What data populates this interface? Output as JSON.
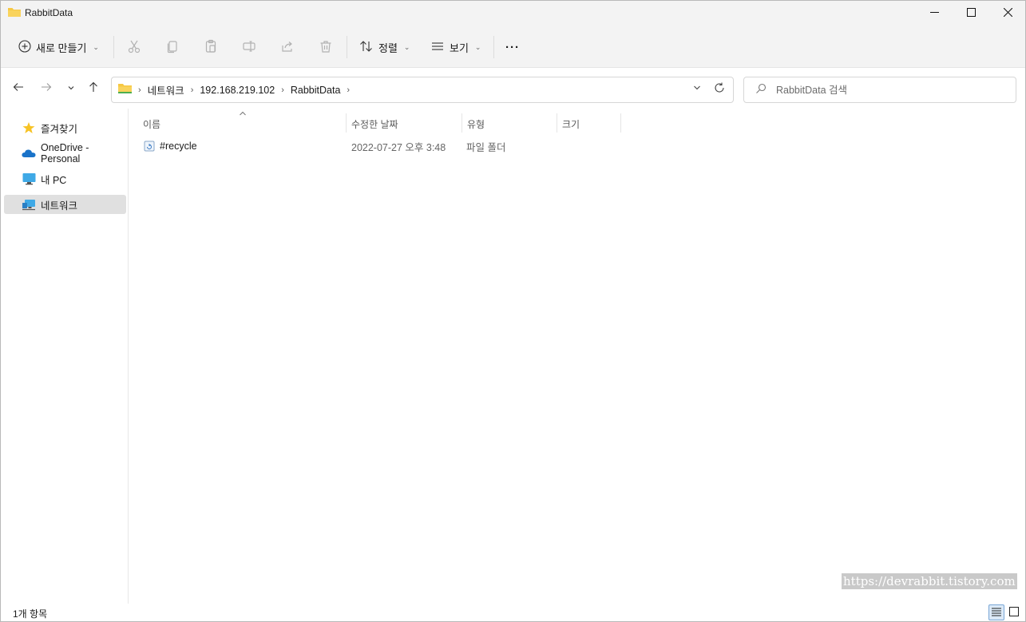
{
  "window": {
    "title": "RabbitData",
    "controls": [
      "minimize-icon",
      "maximize-icon",
      "close-icon"
    ]
  },
  "toolbar": {
    "new_label": "새로 만들기",
    "sort_label": "정렬",
    "view_label": "보기",
    "more_label": "···",
    "disabled_actions": [
      "cut-icon",
      "copy-icon",
      "paste-icon",
      "rename-icon",
      "share-icon",
      "delete-icon"
    ]
  },
  "address": {
    "crumbs": [
      "네트워크",
      "192.168.219.102",
      "RabbitData"
    ]
  },
  "search": {
    "placeholder": "RabbitData 검색"
  },
  "sidebar": {
    "items": [
      {
        "label": "즐겨찾기",
        "icon": "star-icon"
      },
      {
        "label": "OneDrive - Personal",
        "icon": "onedrive-cloud-icon"
      },
      {
        "label": "내 PC",
        "icon": "pc-monitor-icon"
      },
      {
        "label": "네트워크",
        "icon": "network-icon",
        "selected": true
      }
    ]
  },
  "columns": {
    "name": "이름",
    "modified": "수정한 날짜",
    "type": "유형",
    "size": "크기"
  },
  "files": [
    {
      "name": "#recycle",
      "modified": "2022-07-27 오후 3:48",
      "type": "파일 폴더",
      "size": "",
      "icon": "recycle-folder-icon"
    }
  ],
  "status": {
    "count": "1개 항목"
  },
  "watermark": "https://devrabbit.tistory.com",
  "colors": {
    "chrome": "#f3f3f3",
    "folder_yellow": "#f6c843",
    "selection": "#e0e0e0"
  }
}
